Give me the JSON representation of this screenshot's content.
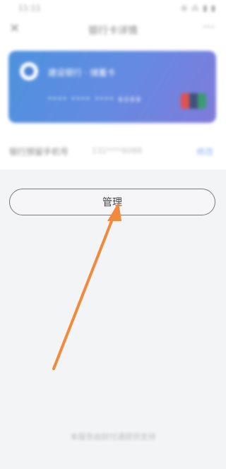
{
  "status_bar": {
    "time": "11:11",
    "icons": "⊛ ⁂ ▮ ▮"
  },
  "nav": {
    "close_icon": "✕",
    "title": "银行卡详情",
    "more_icon": "···"
  },
  "card": {
    "bank_name": "建设银行 · 储蓄卡",
    "masked_number": "**** **** **** 6088",
    "brand_icon": "unionpay-icon"
  },
  "payment_row": {
    "label": "银行预留手机号",
    "value": "132****6088",
    "link": "修改"
  },
  "manage_button": {
    "label": "管理"
  },
  "annotation": {
    "arrow_color": "#f08a3c"
  },
  "footer": {
    "text": "本服务由财付通提供支持"
  }
}
